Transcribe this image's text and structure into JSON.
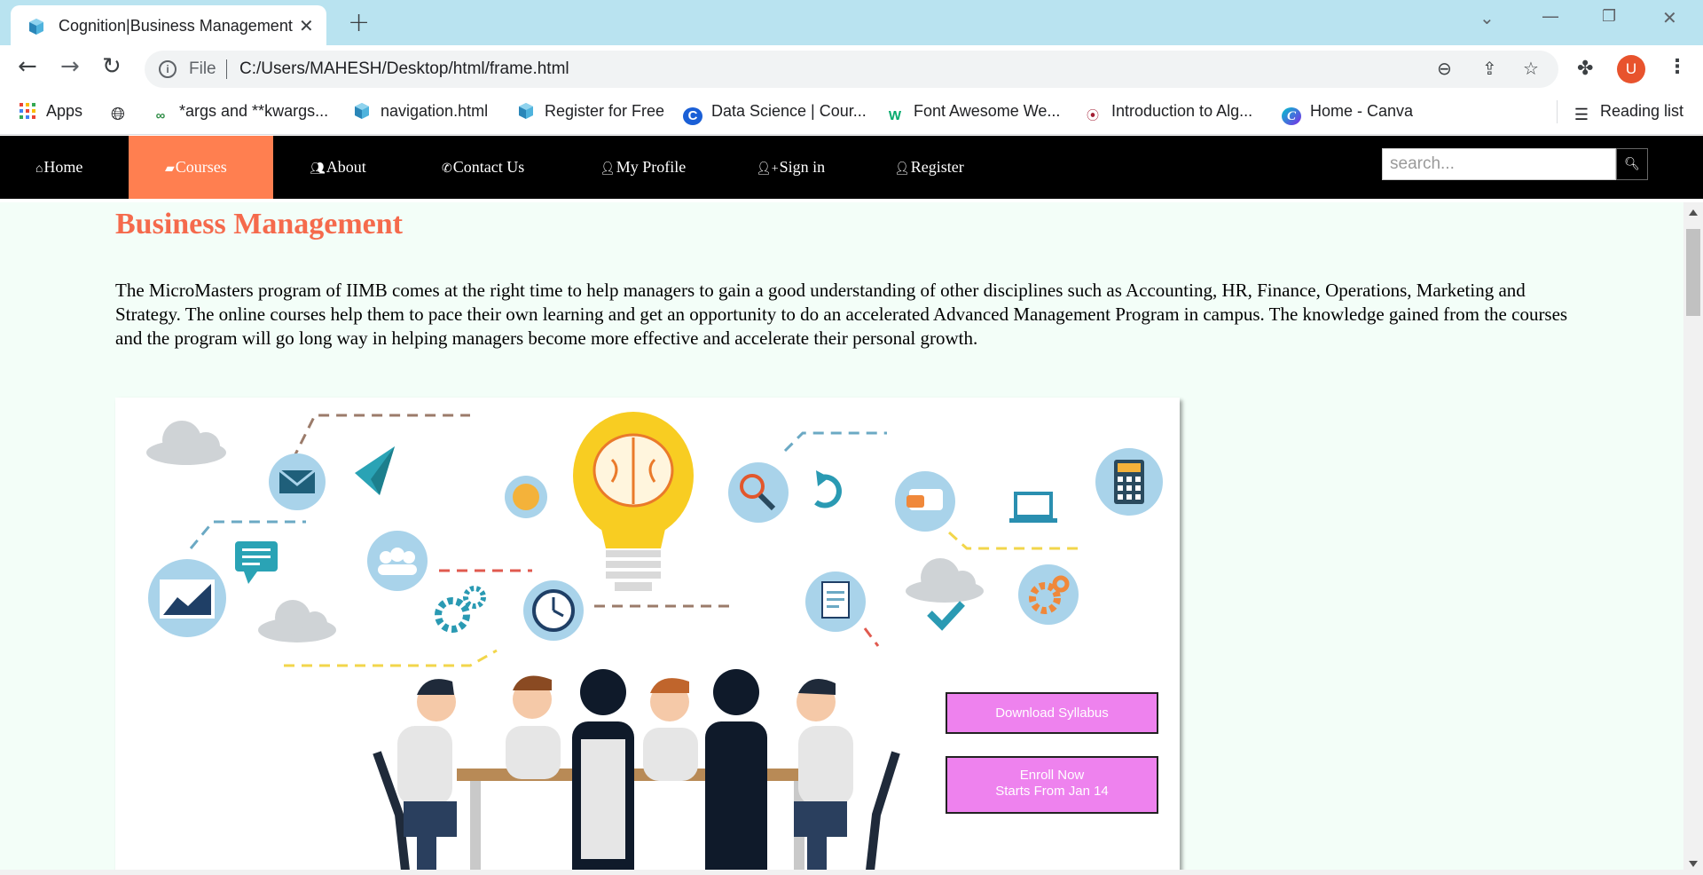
{
  "browser": {
    "tab_title": "Cognition|Business Management",
    "url_scheme": "File",
    "url": "C:/Users/MAHESH/Desktop/html/frame.html",
    "profile_initial": "U",
    "bookmarks": [
      {
        "label": "Apps",
        "icon": "apps-grid-icon"
      },
      {
        "label": "",
        "icon": "globe-icon"
      },
      {
        "label": "*args and **kwargs...",
        "icon": "geeksforgeeks-icon"
      },
      {
        "label": "navigation.html",
        "icon": "file-icon"
      },
      {
        "label": "Register for Free",
        "icon": "file-icon"
      },
      {
        "label": "Data Science | Cour...",
        "icon": "coursera-icon"
      },
      {
        "label": "Font Awesome We...",
        "icon": "w3schools-icon"
      },
      {
        "label": "Introduction to Alg...",
        "icon": "mit-icon"
      },
      {
        "label": "Home - Canva",
        "icon": "canva-icon"
      }
    ],
    "reading_list": "Reading list"
  },
  "nav": {
    "items": [
      {
        "label": "Home",
        "icon": "home-icon"
      },
      {
        "label": "Courses",
        "icon": "book-icon",
        "active": true
      },
      {
        "label": "About",
        "icon": "users-icon"
      },
      {
        "label": "Contact Us",
        "icon": "phone-icon"
      },
      {
        "label": "My Profile",
        "icon": "user-icon"
      },
      {
        "label": "Sign in",
        "icon": "user-plus-icon"
      },
      {
        "label": "Register",
        "icon": "user-icon"
      }
    ],
    "search_placeholder": "search...",
    "active_color": "#ff7f50"
  },
  "page": {
    "title": "Business Management",
    "description": "The MicroMasters program of IIMB comes at the right time to help managers to gain a good understanding of other disciplines such as Accounting, HR, Finance, Operations, Marketing and Strategy.  The online courses help them to pace their own learning and get an opportunity to do an accelerated Advanced Management Program in campus. The knowledge gained from the courses and the program will go long way in helping managers become more effective and accelerate their personal growth.",
    "download_label": "Download Syllabus",
    "enroll_label": "Enroll Now",
    "enroll_sub": "Starts From Jan 14",
    "title_color": "#f56a4c",
    "cta_color": "#ee82ee"
  }
}
